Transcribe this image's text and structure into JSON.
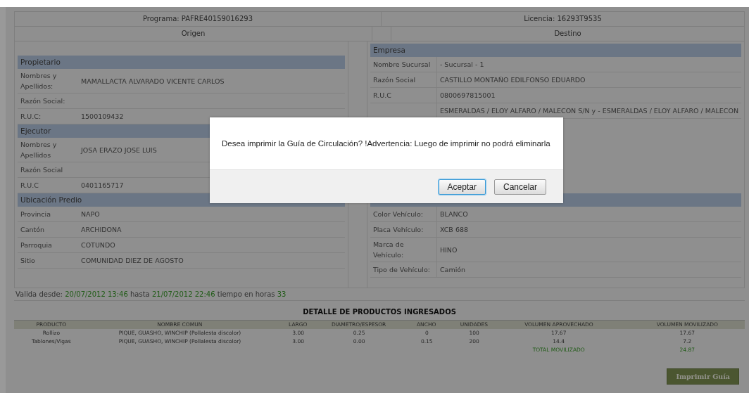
{
  "program": "Programa: PAFRE40159016293",
  "license": "Licencia: 16293T9535",
  "origin_title": "Origen",
  "destination_title": "Destino",
  "origin": [
    {
      "kind": "blank"
    },
    {
      "kind": "header",
      "title": "Propietario"
    },
    {
      "kind": "field",
      "label": "Nombres y Apellidos:",
      "value": "MAMALLACTA ALVARADO VICENTE CARLOS"
    },
    {
      "kind": "field",
      "label": "Razón Social:"
    },
    {
      "kind": "field",
      "label": "R.U.C:",
      "value": "1500109432"
    },
    {
      "kind": "header",
      "title": "Ejecutor"
    },
    {
      "kind": "field",
      "label": "Nombres y Apellidos",
      "value": "JOSA ERAZO JOSE LUIS"
    },
    {
      "kind": "field",
      "label": "Razón Social"
    },
    {
      "kind": "field",
      "label": "R.U.C",
      "value": "0401165717"
    },
    {
      "kind": "header",
      "title": "Ubicación Predio"
    },
    {
      "kind": "field",
      "label": "Provincia",
      "value": "NAPO"
    },
    {
      "kind": "field",
      "label": "Cantón",
      "value": "ARCHIDONA"
    },
    {
      "kind": "field",
      "label": "Parroquia",
      "value": "COTUNDO"
    },
    {
      "kind": "field",
      "label": "Sitio",
      "value": "COMUNIDAD DIEZ DE AGOSTO"
    }
  ],
  "destination": [
    {
      "kind": "header",
      "title": "Empresa"
    },
    {
      "kind": "field",
      "label": "Nombre Sucursal",
      "value": "- Sucursal - 1"
    },
    {
      "kind": "field",
      "label": "Razón Social",
      "value": "CASTILLO MONTAÑO EDILFONSO EDUARDO"
    },
    {
      "kind": "field",
      "label": "R.U.C",
      "value": "0800697815001"
    },
    {
      "kind": "field",
      "value": "ESMERALDAS / ELOY ALFARO / MALECON S/N y - ESMERALDAS / ELOY ALFARO / MALECON"
    },
    {
      "kind": "blank"
    },
    {
      "kind": "header"
    },
    {
      "kind": "field",
      "label": "Color Vehículo:",
      "value": "BLANCO"
    },
    {
      "kind": "field",
      "label": "Placa Vehículo:",
      "value": "XCB 688"
    },
    {
      "kind": "field",
      "label": "Marca de Vehículo:",
      "value": "HINO"
    },
    {
      "kind": "field",
      "label": "Tipo de Vehículo:",
      "value": "Camión"
    }
  ],
  "validity": [
    {
      "text": "Valida desde:",
      "highlight": false
    },
    {
      "text": "20/07/2012 13:46",
      "highlight": true
    },
    {
      "text": "hasta",
      "highlight": false
    },
    {
      "text": "21/07/2012 22:46",
      "highlight": true
    },
    {
      "text": "tiempo en horas",
      "highlight": false
    },
    {
      "text": "33",
      "highlight": true
    }
  ],
  "products": {
    "title": "DETALLE DE PRODUCTOS INGRESADOS",
    "columns": [
      "PRODUCTO",
      "NOMBRE COMUN",
      "LARGO",
      "DIAMETRO/ESPESOR",
      "ANCHO",
      "UNIDADES",
      "VOLUMEN APROVECHADO",
      "VOLUMEN MOVILIZADO"
    ],
    "rows": [
      [
        "Rollizo",
        "PIQUE, GUASHO, WINCHIP (Pollalesta discolor)",
        "3.00",
        "0.25",
        "0",
        "100",
        "17.67",
        "17.67"
      ],
      [
        "Tablones/Vigas",
        "PIQUE, GUASHO, WINCHIP (Pollalesta discolor)",
        "3.00",
        "0.00",
        "0.15",
        "200",
        "14.4",
        "7.2"
      ]
    ],
    "total": {
      "label": "TOTAL MOVILIZADO",
      "value": "24.87"
    }
  },
  "print_button": "Imprimir Guía",
  "dialog": {
    "message": "Desea imprimir la Guía de Circulación? !Advertencia: Luego de imprimir no podrá eliminarla",
    "buttons": [
      {
        "label": "Aceptar",
        "focused": true
      },
      {
        "label": "Cancelar",
        "focused": false
      }
    ]
  }
}
